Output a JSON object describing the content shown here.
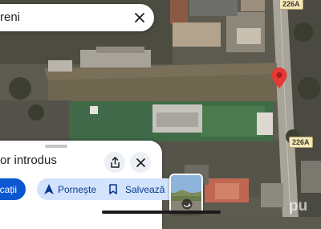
{
  "search": {
    "query": "reni"
  },
  "map": {
    "road_labels": [
      {
        "text": "226A"
      },
      {
        "text": "226A"
      }
    ]
  },
  "place_sheet": {
    "title": "or introdus",
    "actions": {
      "primary_label": "icații",
      "start_label": "Pornește",
      "save_label": "Salvează"
    }
  },
  "watermark": {
    "text": "pu"
  },
  "colors": {
    "accent": "#0b57d0",
    "chip_bg": "#d3e3fd",
    "pin": "#e53935",
    "road_label_bg": "#f6e8b9"
  },
  "icons": {
    "close": "close-icon",
    "share": "share-icon",
    "navigate": "navigation-arrow-icon",
    "bookmark": "bookmark-icon",
    "pin": "map-pin-icon",
    "street_view": "street-view-icon"
  }
}
